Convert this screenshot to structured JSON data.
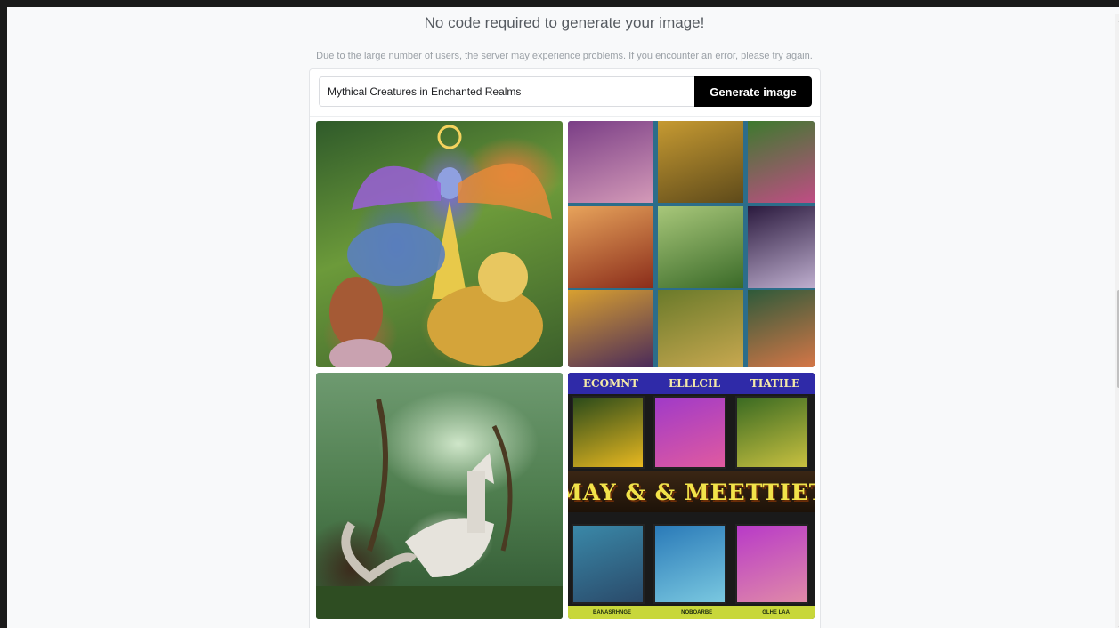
{
  "header": {
    "title": "No code required to generate your image!",
    "notice": "Due to the large number of users, the server may experience problems. If you encounter an error, please try again."
  },
  "generator": {
    "prompt_value": "Mythical Creatures in Enchanted Realms",
    "generate_label": "Generate image"
  },
  "images": {
    "tile4": {
      "top_labels": [
        "ECOMNT",
        "ELLLCIL",
        "TIATILE"
      ],
      "banner_text": "AMAY & & MEETTIETS",
      "bottom_labels": [
        "BANASRHNGE",
        "NOBOARBE",
        "GLHE LAA"
      ]
    }
  },
  "scrollbar": {
    "up_icon": "▲",
    "down_icon": "▼"
  }
}
